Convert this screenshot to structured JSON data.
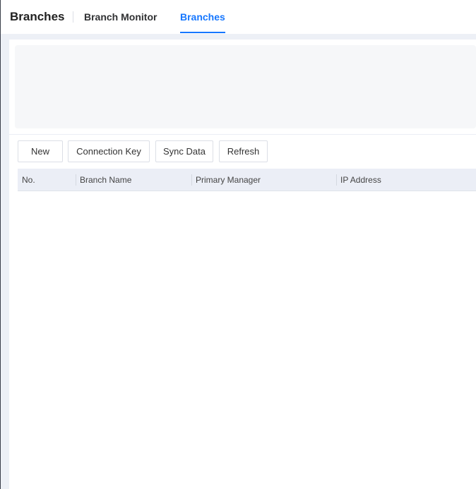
{
  "header": {
    "title": "Branches",
    "tabs": [
      {
        "label": "Branch Monitor"
      },
      {
        "label": "Branches"
      }
    ]
  },
  "toolbar": {
    "new": "New",
    "connection_key": "Connection Key",
    "sync_data": "Sync Data",
    "refresh": "Refresh"
  },
  "table": {
    "columns": [
      "No.",
      "Branch Name",
      "Primary Manager",
      "IP Address"
    ]
  },
  "colors": {
    "accent": "#1677ff"
  }
}
